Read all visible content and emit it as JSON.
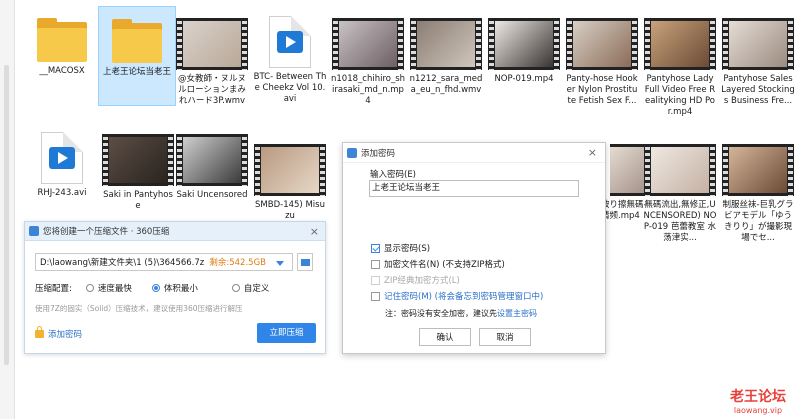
{
  "files": [
    {
      "label": "__MACOSX",
      "icon": "folder-icon",
      "selected": false
    },
    {
      "label": "上老王论坛当老王",
      "icon": "folder-icon",
      "selected": true
    },
    {
      "label": "@女教師・ヌルヌルローションまみれハード3P.wmv",
      "icon": "video-thumb",
      "selected": false
    },
    {
      "label": "BTC- Between The Cheekz Vol 10.avi",
      "icon": "video-file-icon",
      "selected": false
    },
    {
      "label": "n1018_chihiro_shirasaki_md_n.mp4",
      "icon": "video-thumb",
      "selected": false
    },
    {
      "label": "n1212_sara_meda_eu_n_fhd.wmv",
      "icon": "video-thumb",
      "selected": false
    },
    {
      "label": "NOP-019.mp4",
      "icon": "video-thumb",
      "selected": false
    },
    {
      "label": "Panty-hose Hooker Nylon Prostitute Fetish Sex  F...",
      "icon": "video-thumb",
      "selected": false
    },
    {
      "label": "Pantyhose Lady Full Video  Free Realityking HD Por.mp4",
      "icon": "video-thumb",
      "selected": false
    },
    {
      "label": "Pantyhose Sales Layered Stockings Business  Fre...",
      "icon": "video-thumb",
      "selected": false
    },
    {
      "label": "RHJ-243.avi",
      "icon": "video-file-icon",
      "selected": false
    },
    {
      "label": "Saki in Pantyhose",
      "icon": "video-thumb",
      "selected": false
    },
    {
      "label": "Saki Uncensored",
      "icon": "video-thumb",
      "selected": false
    },
    {
      "label": "SMBD-145) Misuzu",
      "icon": "video-thumb",
      "selected": false
    },
    {
      "label": "破り擦無碼-情频.mp4",
      "icon": "video-thumb",
      "selected": false
    },
    {
      "label": "無碼流出,無修正,UNCENSORED) NOP-019 芭蕾教室 水荡津实...",
      "icon": "video-thumb",
      "selected": false
    },
    {
      "label": "制服丝袜-巨乳グラビアモデル「ゆうきりり」が撮影現場でセ...",
      "icon": "video-thumb",
      "selected": false
    }
  ],
  "compress_dialog": {
    "title": "您将创建一个压缩文件 · 360压缩",
    "close": "×",
    "path": "D:\\laowang\\新建文件夹\\1 (5)\\364566.7z",
    "free_space": "剩余:542.5GB",
    "config_label": "压缩配置:",
    "options": [
      {
        "label": "速度最快",
        "selected": false
      },
      {
        "label": "体积最小",
        "selected": true
      },
      {
        "label": "自定义",
        "selected": false
      }
    ],
    "hint": "使用7Z的固实（Solid）压缩技术，建议使用360压缩进行解压",
    "add_password": "添加密码",
    "start_button": "立即压缩"
  },
  "password_dialog": {
    "title": "添加密码",
    "close": "×",
    "input_label": "输入密码(E)",
    "input_value": "上老王论坛当老王",
    "show_password": "显示密码(S)",
    "encrypt_names": "加密文件名(N) (不支持ZIP格式)",
    "zip_classic": "ZIP经典加密方式(L)",
    "remember": "记住密码(M) (将会备忘到密码管理窗口中)",
    "note_prefix": "注：密码没有安全加密，建议先",
    "note_link": "设置主密码",
    "ok": "确认",
    "cancel": "取消"
  },
  "watermark": {
    "line1": "老王论坛",
    "line2": "laowang.vip"
  },
  "colors": {
    "accent": "#2f86e8",
    "folder": "#f7c94b",
    "selection": "#cce8ff",
    "watermark": "#e9403a"
  }
}
